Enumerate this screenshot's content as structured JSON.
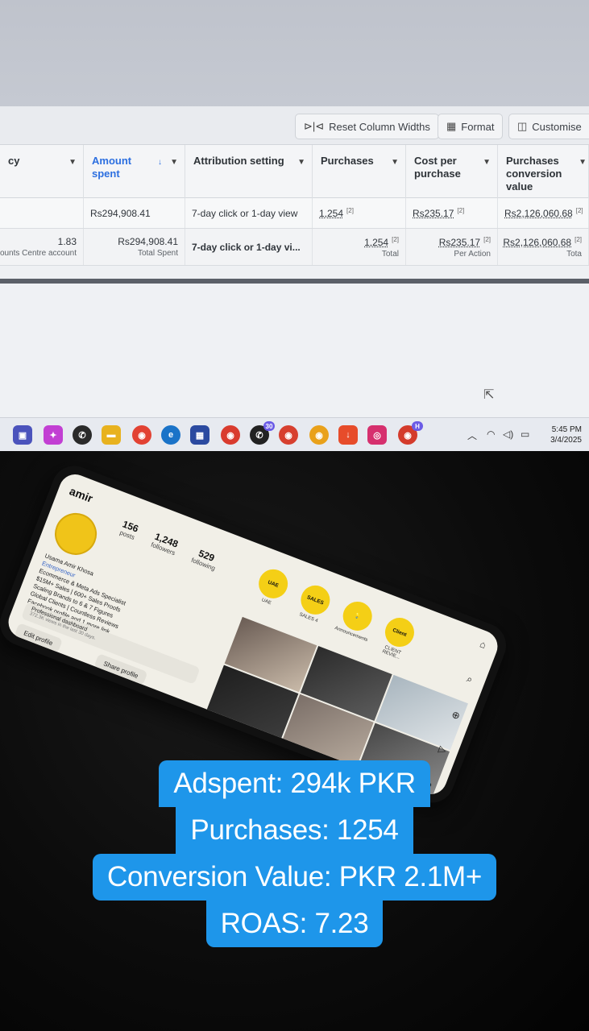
{
  "toolbar": {
    "reset_label": "Reset Column Widths",
    "format_label": "Format",
    "customise_label": "Customise"
  },
  "table": {
    "headers": {
      "currency": "cy",
      "amount_spent": "Amount spent",
      "attribution": "Attribution setting",
      "purchases": "Purchases",
      "cost_per_purchase": "Cost per purchase",
      "conversion_value": "Purchases conversion value"
    },
    "row1": {
      "amount_spent": "Rs294,908.41",
      "attribution": "7-day click or 1-day view",
      "purchases": "1,254",
      "purchases_sup": "[2]",
      "cost": "Rs235.17",
      "cost_sup": "[2]",
      "value": "Rs2,126,060.68",
      "value_sup": "[2]"
    },
    "row2": {
      "currency_val": "1.83",
      "currency_sub": "counts Centre account",
      "amount_spent": "Rs294,908.41",
      "amount_sub": "Total Spent",
      "attribution": "7-day click or 1-day vi...",
      "purchases": "1,254",
      "purchases_sup": "[2]",
      "purchases_sub": "Total",
      "cost": "Rs235.17",
      "cost_sup": "[2]",
      "cost_sub": "Per Action",
      "value": "Rs2,126,060.68",
      "value_sup": "[2]",
      "value_sub": "Tota"
    }
  },
  "taskbar": {
    "whatsapp_badge": "30",
    "chrome_badge": "H",
    "time": "5:45 PM",
    "date": "3/4/2025"
  },
  "phone": {
    "username": "amir",
    "stats": [
      {
        "n": "156",
        "l": "posts"
      },
      {
        "n": "1,248",
        "l": "followers"
      },
      {
        "n": "529",
        "l": "following"
      }
    ],
    "bio_name": "Usama Amir Khosa",
    "bio_category": "Entrepreneur",
    "bio_lines": [
      "Ecommerce & Meta Ads Specialist",
      "$15M+ Sales | 600+ Sales Proofs",
      "Scaling Brands to 6 & 7 Figures",
      "Global Clients | Countless Reviews",
      "Facebook profile and 1 more link"
    ],
    "dashboard_title": "Professional dashboard",
    "dashboard_sub": "372.3K views in the last 30 days.",
    "edit_profile": "Edit profile",
    "share_profile": "Share profile",
    "highlights": [
      {
        "c": "UAE",
        "t": "UAE"
      },
      {
        "c": "SALES",
        "t": "SALES 4"
      },
      {
        "c": "💡",
        "t": "Announcements"
      },
      {
        "c": "Client",
        "t": "CLIENT REVIE..."
      }
    ]
  },
  "caption": {
    "line1": "Adspent: 294k PKR",
    "line2": "Purchases: 1254",
    "line3": "Conversion Value: PKR 2.1M+",
    "line4": "ROAS: 7.23"
  }
}
